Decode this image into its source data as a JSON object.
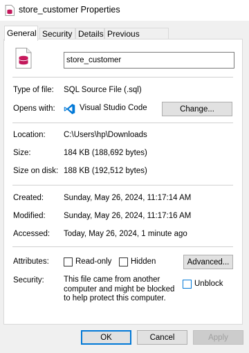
{
  "window": {
    "title": "store_customer Properties"
  },
  "tabs": [
    {
      "label": "General",
      "active": true
    },
    {
      "label": "Security",
      "active": false
    },
    {
      "label": "Details",
      "active": false
    },
    {
      "label": "Previous Versions",
      "active": false
    }
  ],
  "general": {
    "file_name": "store_customer",
    "type_label": "Type of file:",
    "type_value": "SQL Source File (.sql)",
    "opens_label": "Opens with:",
    "opens_value": "Visual Studio Code",
    "change_button": "Change...",
    "location_label": "Location:",
    "location_value": "C:\\Users\\hp\\Downloads",
    "size_label": "Size:",
    "size_value": "184 KB (188,692 bytes)",
    "size_on_disk_label": "Size on disk:",
    "size_on_disk_value": "188 KB (192,512 bytes)",
    "created_label": "Created:",
    "created_value": "Sunday, May 26, 2024, 11:17:14 AM",
    "modified_label": "Modified:",
    "modified_value": "Sunday, May 26, 2024, 11:17:16 AM",
    "accessed_label": "Accessed:",
    "accessed_value": "Today, May 26, 2024, 1 minute ago",
    "attributes_label": "Attributes:",
    "readonly_label": "Read-only",
    "readonly_checked": false,
    "hidden_label": "Hidden",
    "hidden_checked": false,
    "advanced_button": "Advanced...",
    "security_label": "Security:",
    "security_text": "This file came from another computer and might be blocked to help protect this computer.",
    "unblock_label": "Unblock",
    "unblock_checked": false
  },
  "footer": {
    "ok_button": "OK",
    "cancel_button": "Cancel",
    "apply_button": "Apply",
    "apply_enabled": false
  },
  "icons": {
    "file_icon": "sql-file-icon",
    "app_icon": "vscode-icon",
    "accent": "#c2185b",
    "vscode_blue": "#0078d7"
  }
}
